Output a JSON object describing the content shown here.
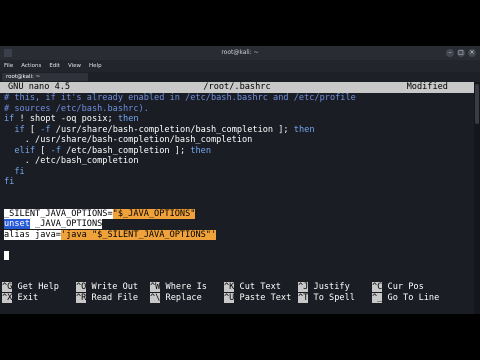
{
  "window": {
    "title": "root@kali: ~",
    "menu": [
      "File",
      "Actions",
      "Edit",
      "View",
      "Help"
    ],
    "tab_label": "root@kali: ~"
  },
  "nano": {
    "version": "GNU nano 4.5",
    "file": "/root/.bashrc",
    "status": "Modified"
  },
  "lines": [
    [
      {
        "t": "# this, if it's already enabled in /etc/bash.bashrc and /etc/profile",
        "c": "comment"
      }
    ],
    [
      {
        "t": "# sources /etc/bash.bashrc).",
        "c": "comment"
      }
    ],
    [
      {
        "t": "if",
        "c": "kw"
      },
      {
        "t": " ! shopt -oq posix; ",
        "c": ""
      },
      {
        "t": "then",
        "c": "kw"
      }
    ],
    [
      {
        "t": "  ",
        "c": ""
      },
      {
        "t": "if",
        "c": "kw"
      },
      {
        "t": " [ ",
        "c": ""
      },
      {
        "t": "-f",
        "c": "kw"
      },
      {
        "t": " /usr/share/bash-completion/bash_completion ]; ",
        "c": ""
      },
      {
        "t": "then",
        "c": "kw"
      }
    ],
    [
      {
        "t": "    . /usr/share/bash-completion/bash_completion",
        "c": ""
      }
    ],
    [
      {
        "t": "  ",
        "c": ""
      },
      {
        "t": "elif",
        "c": "kw"
      },
      {
        "t": " [ ",
        "c": ""
      },
      {
        "t": "-f",
        "c": "kw"
      },
      {
        "t": " /etc/bash_completion ]; ",
        "c": ""
      },
      {
        "t": "then",
        "c": "kw"
      }
    ],
    [
      {
        "t": "    . /etc/bash_completion",
        "c": ""
      }
    ],
    [
      {
        "t": "  ",
        "c": ""
      },
      {
        "t": "fi",
        "c": "kw"
      }
    ],
    [
      {
        "t": "fi",
        "c": "kw"
      }
    ],
    [],
    [],
    [
      {
        "t": "_SILENT_JAVA_OPTIONS=",
        "c": "hl-sel"
      },
      {
        "t": "\"$_JAVA_OPTIONS\"",
        "c": "hl-orange"
      }
    ],
    [
      {
        "t": "unset",
        "c": "hl-blue"
      },
      {
        "t": " _JAVA_OPTIONS",
        "c": "hl-sel"
      }
    ],
    [
      {
        "t": "alias java=",
        "c": "hl-sel"
      },
      {
        "t": "'java \"$_SILENT_JAVA_OPTIONS\"'",
        "c": "hl-orange"
      }
    ],
    [],
    [
      {
        "t": "",
        "c": "cursor"
      }
    ]
  ],
  "shortcuts_row1": [
    {
      "key": "^G",
      "label": "Get Help"
    },
    {
      "key": "^O",
      "label": "Write Out"
    },
    {
      "key": "^W",
      "label": "Where Is"
    },
    {
      "key": "^K",
      "label": "Cut Text"
    },
    {
      "key": "^J",
      "label": "Justify"
    },
    {
      "key": "^C",
      "label": "Cur Pos"
    }
  ],
  "shortcuts_row2": [
    {
      "key": "^X",
      "label": "Exit"
    },
    {
      "key": "^R",
      "label": "Read File"
    },
    {
      "key": "^\\",
      "label": "Replace"
    },
    {
      "key": "^U",
      "label": "Paste Text"
    },
    {
      "key": "^T",
      "label": "To Spell"
    },
    {
      "key": "^_",
      "label": "Go To Line"
    }
  ]
}
